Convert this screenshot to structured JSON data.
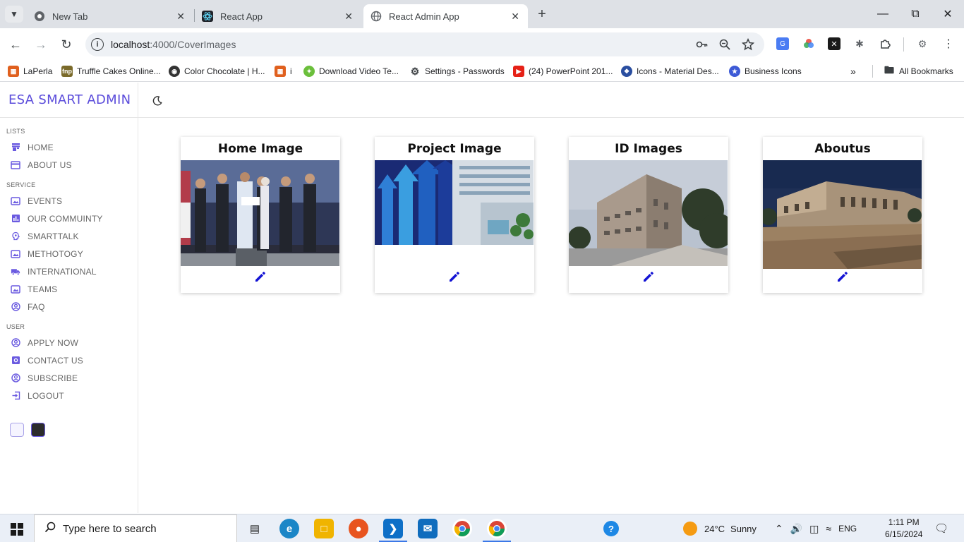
{
  "browser": {
    "tabs": [
      {
        "title": "New Tab",
        "icon": "chrome-icon"
      },
      {
        "title": "React App",
        "icon": "react-icon"
      },
      {
        "title": "React Admin App",
        "icon": "globe-icon",
        "active": true
      }
    ],
    "url_host": "localhost",
    "url_path": ":4000/CoverImages",
    "bookmarks": [
      {
        "label": "LaPerla",
        "color": "#e0601e"
      },
      {
        "label": "Truffle Cakes Online...",
        "color": "#7a6a2a"
      },
      {
        "label": "Color Chocolate | H...",
        "color": "#333333"
      },
      {
        "label": "i",
        "color": "#e0601e"
      },
      {
        "label": "Download Video Te...",
        "color": "#6bbf3b"
      },
      {
        "label": "Settings - Passwords",
        "color": "#3c4043"
      },
      {
        "label": "(24) PowerPoint 201...",
        "color": "#e62117"
      },
      {
        "label": "Icons - Material Des...",
        "color": "#2a4ea0"
      },
      {
        "label": "Business Icons",
        "color": "#3d5ad6"
      }
    ],
    "all_bookmarks": "All Bookmarks"
  },
  "app": {
    "brand": "ESA SMART ADMIN",
    "accent": "#6a5ae0",
    "sections": [
      {
        "label": "LISTS",
        "items": [
          {
            "label": "HOME",
            "icon": "store-icon"
          },
          {
            "label": "ABOUT US",
            "icon": "credit-card-icon"
          }
        ]
      },
      {
        "label": "SERVICE",
        "items": [
          {
            "label": "EVENTS",
            "icon": "image-icon"
          },
          {
            "label": "OUR COMMUINTY",
            "icon": "chart-icon"
          },
          {
            "label": "SMARTTALK",
            "icon": "brain-icon"
          },
          {
            "label": "METHOTOGY",
            "icon": "image-icon"
          },
          {
            "label": "INTERNATIONAL",
            "icon": "truck-icon"
          },
          {
            "label": "TEAMS",
            "icon": "image-icon"
          },
          {
            "label": "FAQ",
            "icon": "account-circle-icon"
          }
        ]
      },
      {
        "label": "USER",
        "items": [
          {
            "label": "APPLY NOW",
            "icon": "account-circle-icon"
          },
          {
            "label": "CONTACT US",
            "icon": "settings-applications-icon"
          },
          {
            "label": "SUBSCRIBE",
            "icon": "account-circle-icon"
          },
          {
            "label": "LOGOUT",
            "icon": "exit-icon"
          }
        ]
      }
    ],
    "cards": [
      {
        "title": "Home Image",
        "scene": "ceremony"
      },
      {
        "title": "Project Image",
        "scene": "arrows-building"
      },
      {
        "title": "ID Images",
        "scene": "building-street"
      },
      {
        "title": "Aboutus",
        "scene": "building-plaza"
      }
    ]
  },
  "taskbar": {
    "search_placeholder": "Type here to search",
    "weather_temp": "24°C",
    "weather_text": "Sunny",
    "language": "ENG",
    "time": "1:11 PM",
    "date": "6/15/2024"
  }
}
